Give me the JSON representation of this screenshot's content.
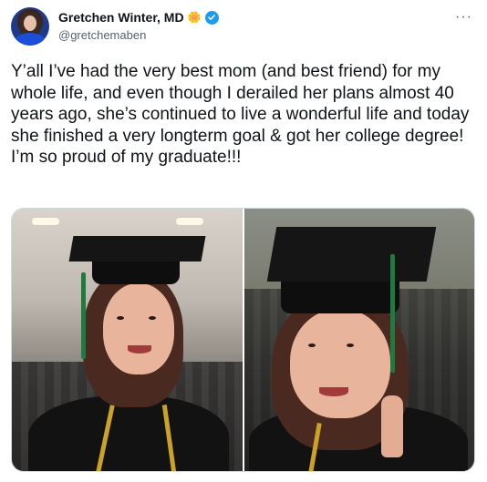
{
  "tweet": {
    "display_name": "Gretchen Winter, MD",
    "name_emoji": "🌼",
    "handle": "@gretchemaben",
    "more_label": "···",
    "text": "Y’all I’ve had the very best mom (and best friend) for my whole life, and even though I derailed her plans almost 40 years ago, she’s continued to live a wonderful life and today she finished a very longterm goal & got her college degree! I’m so proud of my graduate!!!",
    "icons": {
      "verified": "verified-badge-icon",
      "more": "more-options-icon"
    },
    "colors": {
      "verified": "#1d9bf0",
      "secondary_text": "#536471",
      "primary_text": "#0f1419"
    }
  }
}
